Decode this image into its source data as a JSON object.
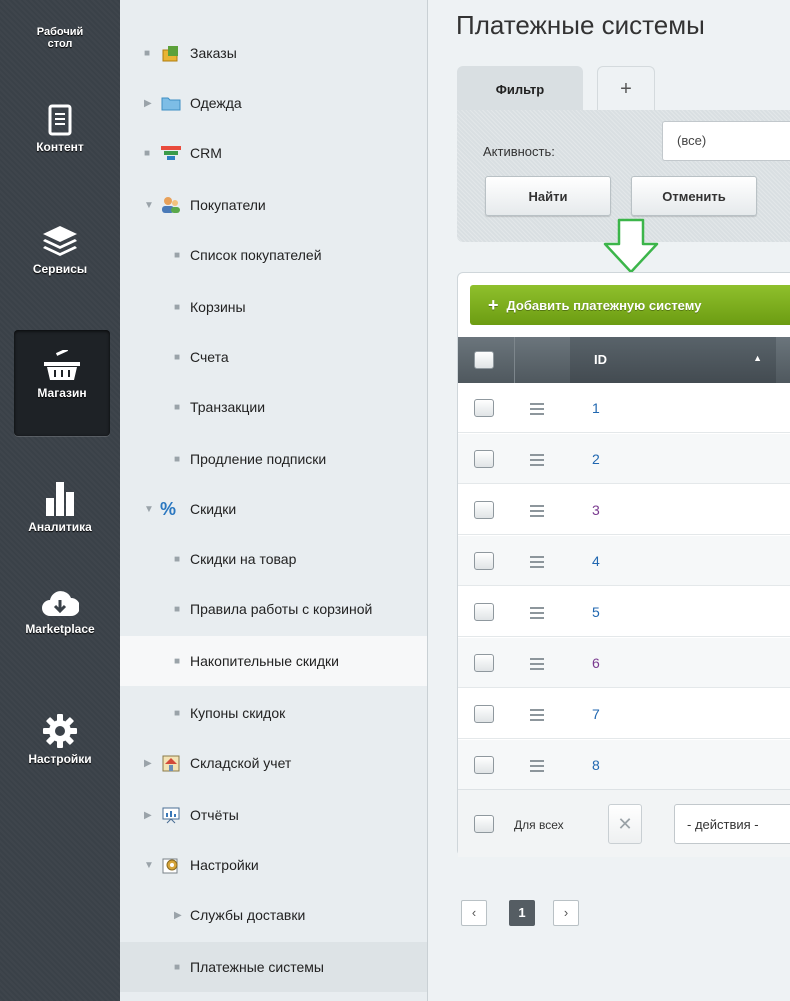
{
  "appbar": {
    "items": [
      {
        "label": "Рабочий стол",
        "icon": "desktop"
      },
      {
        "label": "Контент",
        "icon": "document-icon"
      },
      {
        "label": "Сервисы",
        "icon": "layers-icon"
      },
      {
        "label": "Магазин",
        "icon": "basket-icon",
        "active": true
      },
      {
        "label": "Аналитика",
        "icon": "bar-chart-icon"
      },
      {
        "label": "Marketplace",
        "icon": "cloud-download-icon"
      },
      {
        "label": "Настройки",
        "icon": "gear-icon"
      }
    ],
    "desktop_line1": "Рабочий",
    "desktop_line2": "стол"
  },
  "menu": {
    "items": [
      {
        "label": "Заказы"
      },
      {
        "label": "Одежда"
      },
      {
        "label": "CRM"
      },
      {
        "label": "Покупатели"
      },
      {
        "label": "Список покупателей"
      },
      {
        "label": "Корзины"
      },
      {
        "label": "Счета"
      },
      {
        "label": "Транзакции"
      },
      {
        "label": "Продление подписки"
      },
      {
        "label": "Скидки"
      },
      {
        "label": "Скидки на товар"
      },
      {
        "label": "Правила работы с корзиной"
      },
      {
        "label": "Накопительные скидки"
      },
      {
        "label": "Купоны скидок"
      },
      {
        "label": "Складской учет"
      },
      {
        "label": "Отчёты"
      },
      {
        "label": "Настройки"
      },
      {
        "label": "Службы доставки"
      },
      {
        "label": "Платежные системы"
      }
    ]
  },
  "main": {
    "title": "Платежные системы",
    "filter": {
      "tab_label": "Фильтр",
      "add_tab_label": "+",
      "activity_label": "Активность:",
      "activity_value": "(все)",
      "find_label": "Найти",
      "cancel_label": "Отменить"
    },
    "grid": {
      "add_label": "Добавить платежную систему",
      "add_plus": "+",
      "id_header": "ID",
      "sort_arrow": "▲",
      "rows": [
        "1",
        "2",
        "3",
        "4",
        "5",
        "6",
        "7",
        "8"
      ],
      "for_all_label": "Для всех",
      "clear_label": "✕",
      "actions_label": "- действия -"
    },
    "pager": {
      "prev": "‹",
      "current": "1",
      "next": "›"
    }
  },
  "colors": {
    "appbar_bg": "#3a4148",
    "accent_green": "#7cae1c",
    "link_blue": "#2067b0",
    "arrow_green": "#3cb54a",
    "arrow_blue": "#1aa3e8"
  }
}
